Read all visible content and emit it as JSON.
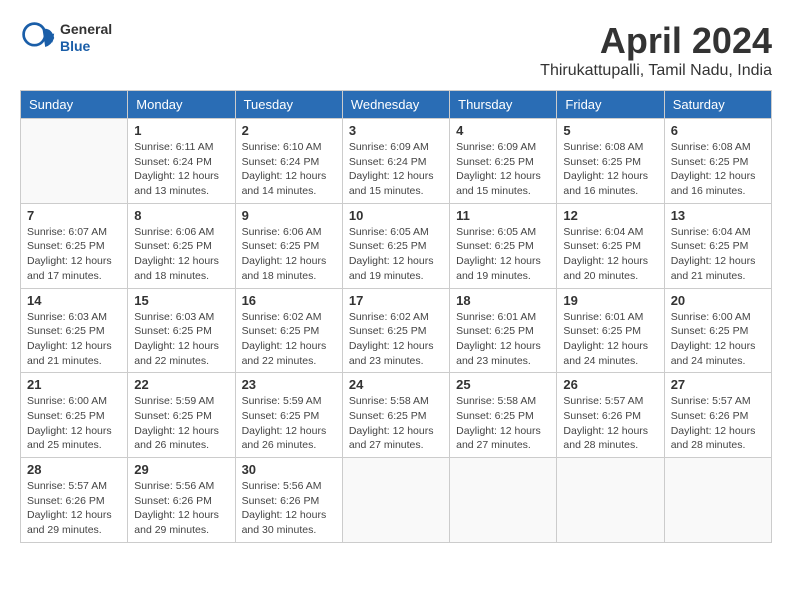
{
  "header": {
    "logo": {
      "general": "General",
      "blue": "Blue"
    },
    "title": "April 2024",
    "subtitle": "Thirukattupalli, Tamil Nadu, India"
  },
  "calendar": {
    "days_of_week": [
      "Sunday",
      "Monday",
      "Tuesday",
      "Wednesday",
      "Thursday",
      "Friday",
      "Saturday"
    ],
    "weeks": [
      [
        {
          "day": "",
          "info": ""
        },
        {
          "day": "1",
          "info": "Sunrise: 6:11 AM\nSunset: 6:24 PM\nDaylight: 12 hours\nand 13 minutes."
        },
        {
          "day": "2",
          "info": "Sunrise: 6:10 AM\nSunset: 6:24 PM\nDaylight: 12 hours\nand 14 minutes."
        },
        {
          "day": "3",
          "info": "Sunrise: 6:09 AM\nSunset: 6:24 PM\nDaylight: 12 hours\nand 15 minutes."
        },
        {
          "day": "4",
          "info": "Sunrise: 6:09 AM\nSunset: 6:25 PM\nDaylight: 12 hours\nand 15 minutes."
        },
        {
          "day": "5",
          "info": "Sunrise: 6:08 AM\nSunset: 6:25 PM\nDaylight: 12 hours\nand 16 minutes."
        },
        {
          "day": "6",
          "info": "Sunrise: 6:08 AM\nSunset: 6:25 PM\nDaylight: 12 hours\nand 16 minutes."
        }
      ],
      [
        {
          "day": "7",
          "info": "Sunrise: 6:07 AM\nSunset: 6:25 PM\nDaylight: 12 hours\nand 17 minutes."
        },
        {
          "day": "8",
          "info": "Sunrise: 6:06 AM\nSunset: 6:25 PM\nDaylight: 12 hours\nand 18 minutes."
        },
        {
          "day": "9",
          "info": "Sunrise: 6:06 AM\nSunset: 6:25 PM\nDaylight: 12 hours\nand 18 minutes."
        },
        {
          "day": "10",
          "info": "Sunrise: 6:05 AM\nSunset: 6:25 PM\nDaylight: 12 hours\nand 19 minutes."
        },
        {
          "day": "11",
          "info": "Sunrise: 6:05 AM\nSunset: 6:25 PM\nDaylight: 12 hours\nand 19 minutes."
        },
        {
          "day": "12",
          "info": "Sunrise: 6:04 AM\nSunset: 6:25 PM\nDaylight: 12 hours\nand 20 minutes."
        },
        {
          "day": "13",
          "info": "Sunrise: 6:04 AM\nSunset: 6:25 PM\nDaylight: 12 hours\nand 21 minutes."
        }
      ],
      [
        {
          "day": "14",
          "info": "Sunrise: 6:03 AM\nSunset: 6:25 PM\nDaylight: 12 hours\nand 21 minutes."
        },
        {
          "day": "15",
          "info": "Sunrise: 6:03 AM\nSunset: 6:25 PM\nDaylight: 12 hours\nand 22 minutes."
        },
        {
          "day": "16",
          "info": "Sunrise: 6:02 AM\nSunset: 6:25 PM\nDaylight: 12 hours\nand 22 minutes."
        },
        {
          "day": "17",
          "info": "Sunrise: 6:02 AM\nSunset: 6:25 PM\nDaylight: 12 hours\nand 23 minutes."
        },
        {
          "day": "18",
          "info": "Sunrise: 6:01 AM\nSunset: 6:25 PM\nDaylight: 12 hours\nand 23 minutes."
        },
        {
          "day": "19",
          "info": "Sunrise: 6:01 AM\nSunset: 6:25 PM\nDaylight: 12 hours\nand 24 minutes."
        },
        {
          "day": "20",
          "info": "Sunrise: 6:00 AM\nSunset: 6:25 PM\nDaylight: 12 hours\nand 24 minutes."
        }
      ],
      [
        {
          "day": "21",
          "info": "Sunrise: 6:00 AM\nSunset: 6:25 PM\nDaylight: 12 hours\nand 25 minutes."
        },
        {
          "day": "22",
          "info": "Sunrise: 5:59 AM\nSunset: 6:25 PM\nDaylight: 12 hours\nand 26 minutes."
        },
        {
          "day": "23",
          "info": "Sunrise: 5:59 AM\nSunset: 6:25 PM\nDaylight: 12 hours\nand 26 minutes."
        },
        {
          "day": "24",
          "info": "Sunrise: 5:58 AM\nSunset: 6:25 PM\nDaylight: 12 hours\nand 27 minutes."
        },
        {
          "day": "25",
          "info": "Sunrise: 5:58 AM\nSunset: 6:25 PM\nDaylight: 12 hours\nand 27 minutes."
        },
        {
          "day": "26",
          "info": "Sunrise: 5:57 AM\nSunset: 6:26 PM\nDaylight: 12 hours\nand 28 minutes."
        },
        {
          "day": "27",
          "info": "Sunrise: 5:57 AM\nSunset: 6:26 PM\nDaylight: 12 hours\nand 28 minutes."
        }
      ],
      [
        {
          "day": "28",
          "info": "Sunrise: 5:57 AM\nSunset: 6:26 PM\nDaylight: 12 hours\nand 29 minutes."
        },
        {
          "day": "29",
          "info": "Sunrise: 5:56 AM\nSunset: 6:26 PM\nDaylight: 12 hours\nand 29 minutes."
        },
        {
          "day": "30",
          "info": "Sunrise: 5:56 AM\nSunset: 6:26 PM\nDaylight: 12 hours\nand 30 minutes."
        },
        {
          "day": "",
          "info": ""
        },
        {
          "day": "",
          "info": ""
        },
        {
          "day": "",
          "info": ""
        },
        {
          "day": "",
          "info": ""
        }
      ]
    ]
  }
}
